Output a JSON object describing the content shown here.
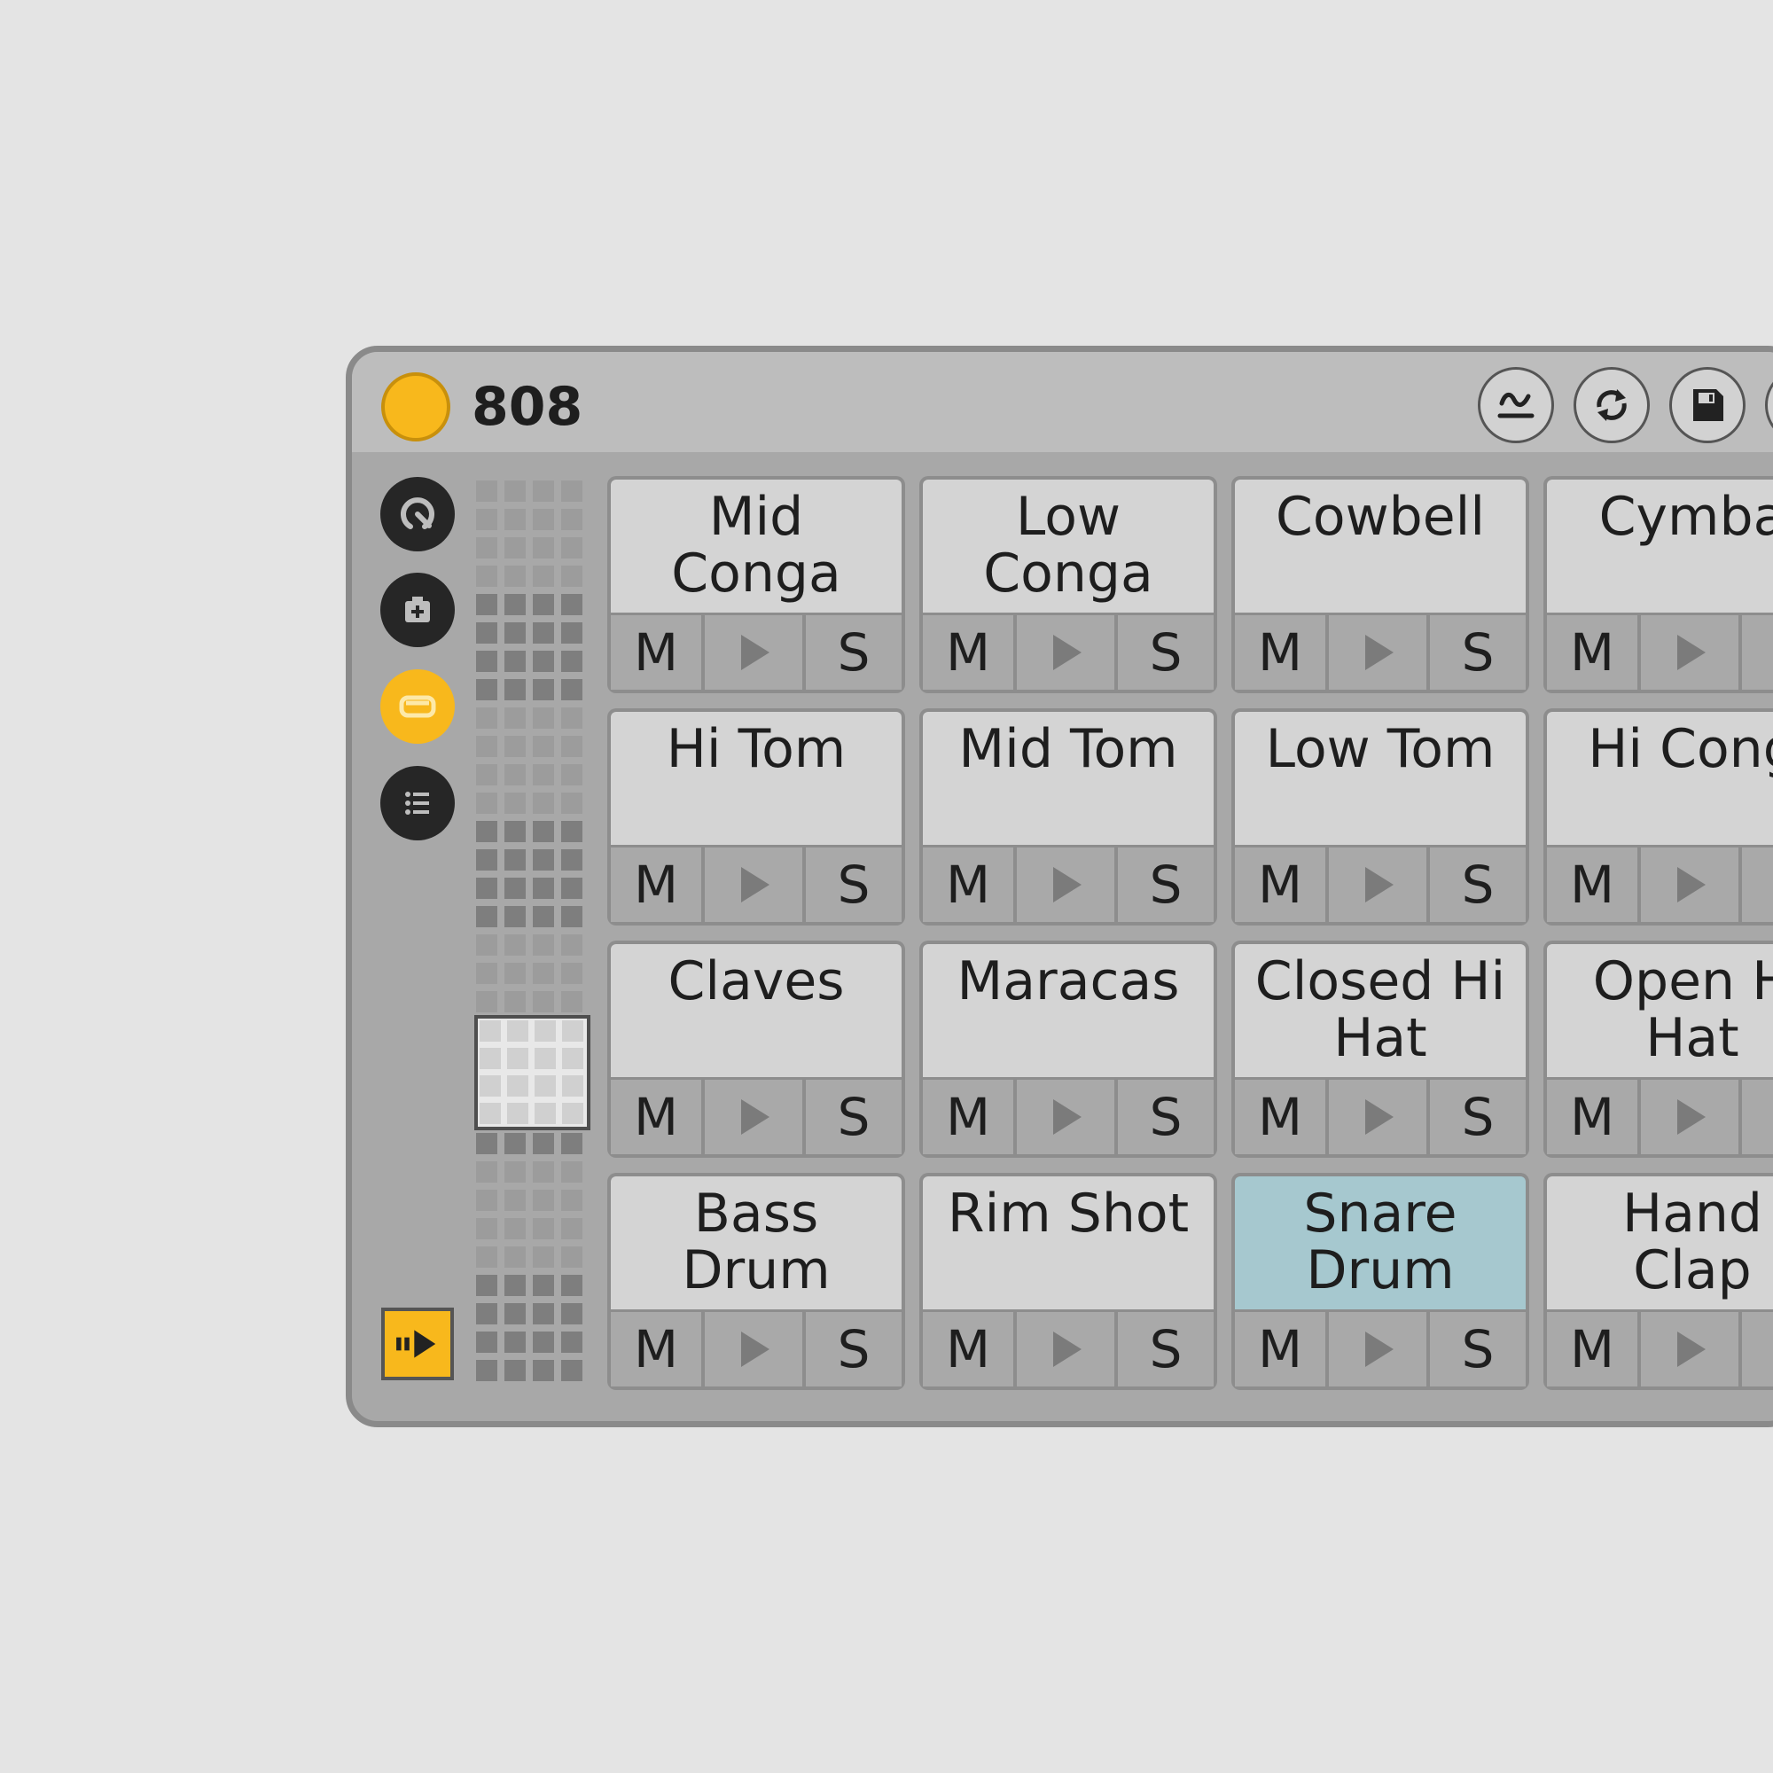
{
  "device": {
    "title": "808",
    "accent_color": "#f8b81c",
    "selected_color": "#a6c8cf",
    "header_icons": [
      "hot-swap-icon",
      "refresh-icon",
      "save-icon"
    ],
    "sidebar_icons": [
      "macro-knob-icon",
      "add-device-icon",
      "chain-view-icon",
      "list-icon"
    ]
  },
  "pads": [
    {
      "name": "Mid\nConga",
      "mute": "M",
      "solo": "S",
      "selected": false
    },
    {
      "name": "Low\nConga",
      "mute": "M",
      "solo": "S",
      "selected": false
    },
    {
      "name": "Cowbell",
      "mute": "M",
      "solo": "S",
      "selected": false
    },
    {
      "name": "Cymba",
      "mute": "M",
      "solo": "",
      "selected": false
    },
    {
      "name": "Hi Tom",
      "mute": "M",
      "solo": "S",
      "selected": false
    },
    {
      "name": "Mid Tom",
      "mute": "M",
      "solo": "S",
      "selected": false
    },
    {
      "name": "Low Tom",
      "mute": "M",
      "solo": "S",
      "selected": false
    },
    {
      "name": "Hi Cong",
      "mute": "M",
      "solo": "",
      "selected": false
    },
    {
      "name": "Claves",
      "mute": "M",
      "solo": "S",
      "selected": false
    },
    {
      "name": "Maracas",
      "mute": "M",
      "solo": "S",
      "selected": false
    },
    {
      "name": "Closed Hi\nHat",
      "mute": "M",
      "solo": "S",
      "selected": false
    },
    {
      "name": "Open H\nHat",
      "mute": "M",
      "solo": "",
      "selected": false
    },
    {
      "name": "Bass\nDrum",
      "mute": "M",
      "solo": "S",
      "selected": false
    },
    {
      "name": "Rim Shot",
      "mute": "M",
      "solo": "S",
      "selected": false
    },
    {
      "name": "Snare\nDrum",
      "mute": "M",
      "solo": "S",
      "selected": true
    },
    {
      "name": "Hand\nClap",
      "mute": "M",
      "solo": "",
      "selected": false
    }
  ]
}
